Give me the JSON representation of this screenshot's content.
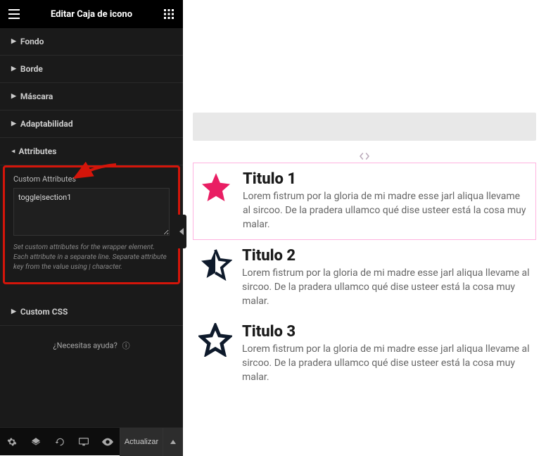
{
  "header": {
    "title": "Editar Caja de icono"
  },
  "panels": {
    "fondo": "Fondo",
    "borde": "Borde",
    "mascara": "Máscara",
    "adaptabilidad": "Adaptabilidad",
    "attributes": "Attributes",
    "custom_css": "Custom CSS"
  },
  "attributes_section": {
    "label": "Custom Attributes",
    "value": "toggle|section1",
    "help": "Set custom attributes for the wrapper element. Each attribute in a separate line. Separate attribute key from the value using | character."
  },
  "help_link": "¿Necesitas ayuda?",
  "footer": {
    "update": "Actualizar"
  },
  "canvas": {
    "items": [
      {
        "title": "Titulo 1",
        "body": "Lorem fistrum por la gloria de mi madre esse jarl aliqua llevame al sircoo. De la pradera ullamco qué dise usteer está la cosa muy malar."
      },
      {
        "title": "Titulo 2",
        "body": "Lorem fistrum por la gloria de mi madre esse jarl aliqua llevame al sircoo. De la pradera ullamco qué dise usteer está la cosa muy malar."
      },
      {
        "title": "Titulo 3",
        "body": "Lorem fistrum por la gloria de mi madre esse jarl aliqua llevame al sircoo. De la pradera ullamco qué dise usteer está la cosa muy malar."
      }
    ]
  },
  "colors": {
    "accent": "#d4150a",
    "pink": "#e91e63"
  }
}
